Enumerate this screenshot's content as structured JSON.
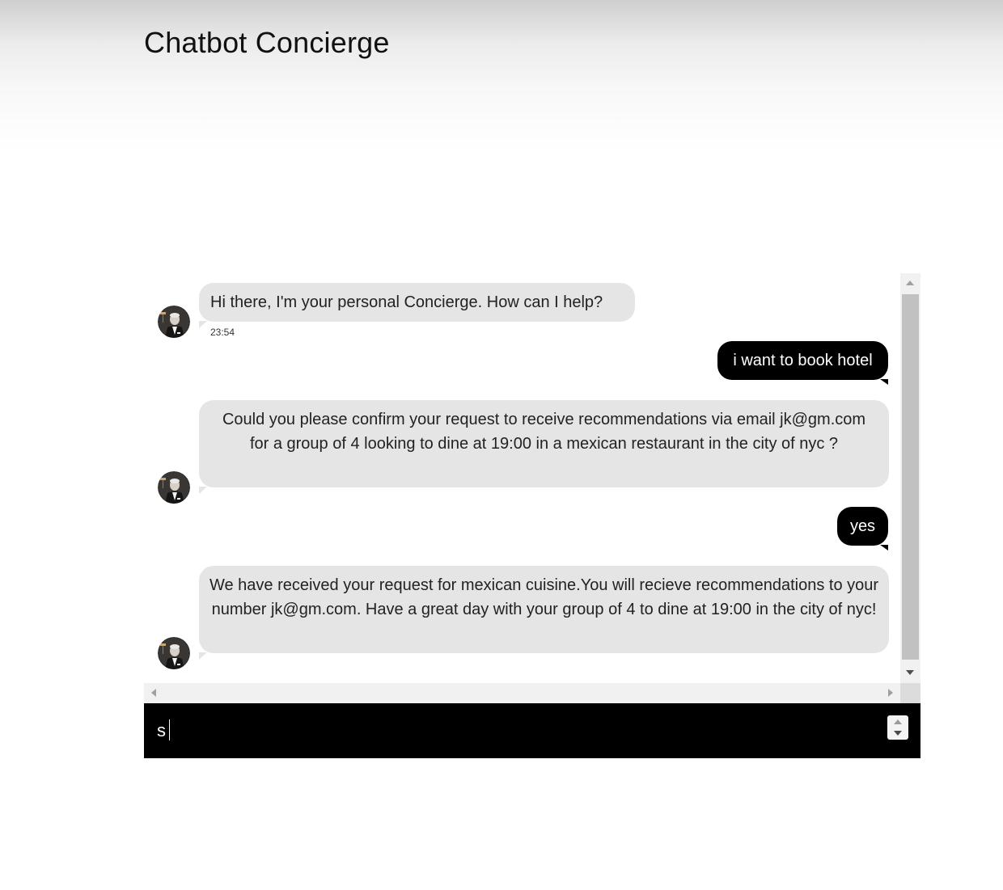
{
  "page": {
    "title": "Chatbot Concierge"
  },
  "messages": [
    {
      "sender": "bot",
      "text": "Hi there, I'm your personal Concierge. How can I help?",
      "time": "23:54"
    },
    {
      "sender": "user",
      "text": "i want to book hotel"
    },
    {
      "sender": "bot",
      "text": "Could you please confirm your request to receive recommendations via email jk@gm.com for a group of 4 looking to dine at 19:00 in a mexican restaurant in the city of nyc ?"
    },
    {
      "sender": "user",
      "text": "yes"
    },
    {
      "sender": "bot",
      "text": "We have received your request for mexican cuisine.You will recieve recommendations to your number jk@gm.com. Have a great day with your group of 4 to dine at 19:00 in the city of nyc!"
    }
  ],
  "input": {
    "value": "s"
  },
  "icons": {
    "avatar": "concierge-avatar-icon",
    "scroll_up": "arrow-up-icon",
    "scroll_down": "arrow-down-icon",
    "scroll_left": "arrow-left-icon",
    "scroll_right": "arrow-right-icon",
    "spinner_up": "spinner-up-icon",
    "spinner_down": "spinner-down-icon"
  },
  "colors": {
    "bot_bubble": "#e5e5e5",
    "user_bubble": "#000000",
    "input_bar": "#000000",
    "scrollbar_thumb": "#c1c1c1"
  }
}
